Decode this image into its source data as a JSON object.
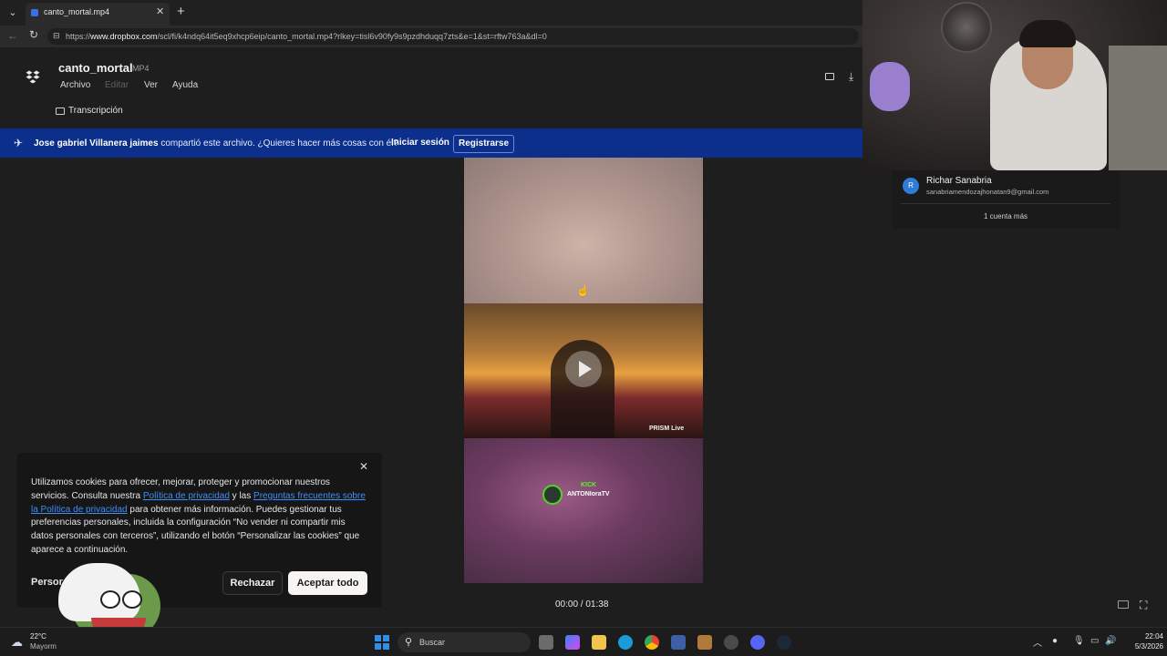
{
  "browser": {
    "tab_title": "canto_mortal.mp4",
    "url_prefix": "https://",
    "url_domain": "www.dropbox.com",
    "url_rest": "/scl/fi/k4ndq64it5eq9xhcp6eip/canto_mortal.mp4?rlkey=tisl6v90fy9s9pzdhduqq7zts&e=1&st=rftw763a&dl=0"
  },
  "file": {
    "name": "canto_mortal",
    "type": "MP4"
  },
  "menu": {
    "archivo": "Archivo",
    "editar": "Editar",
    "ver": "Ver",
    "ayuda": "Ayuda"
  },
  "transcript_label": "Transcripción",
  "share_banner": {
    "sharer": "Jose gabriel Villanera jaimes",
    "message": " compartió este archivo. ¿Quieres hacer más cosas con él?",
    "login": "Iniciar sesión",
    "signup": "Registrarse"
  },
  "video": {
    "prism_label": "PRISM Live",
    "kick_title": "KICK",
    "kick_user": "ANTONIoraTV",
    "time": "00:00 / 01:38"
  },
  "cookie": {
    "text_1": "Utilizamos cookies para ofrecer, mejorar, proteger y promocionar nuestros servicios. Consulta nuestra ",
    "link_privacy": "Política de privacidad",
    "text_2": " y las ",
    "link_faq": "Preguntas frecuentes sobre la Política de privacidad",
    "text_3": " para obtener más información. Puedes gestionar tus preferencias personales, incluida la configuración “No vender ni compartir mis datos personales con terceros”, utilizando el botón “Personalizar las cookies” que aparece a continuación.",
    "personalize": "Persor",
    "reject": "Rechazar",
    "accept": "Aceptar todo"
  },
  "account": {
    "initial": "R",
    "name": "Richar Sanabria",
    "email": "sanabriamendozajhonatan9@gmail.com",
    "more": "1 cuenta más"
  },
  "taskbar": {
    "temp": "22°C",
    "weather": "Mayorm",
    "search": "Buscar",
    "time": "22:04",
    "date": "5/3/2026"
  }
}
